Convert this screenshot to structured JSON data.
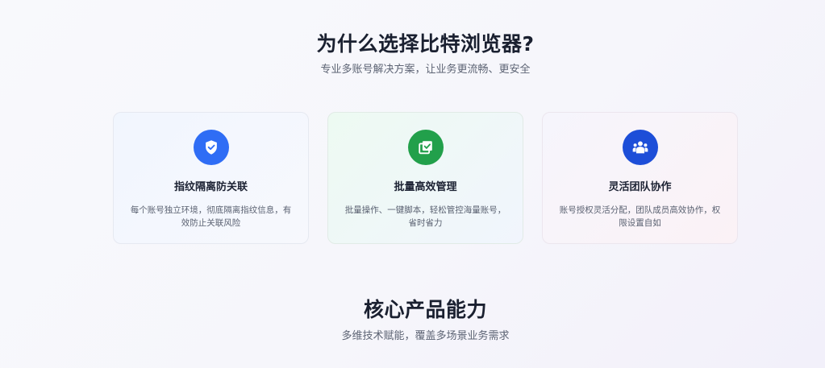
{
  "why_section": {
    "title": "为什么选择比特浏览器?",
    "subtitle": "专业多账号解决方案，让业务更流畅、更安全"
  },
  "features": [
    {
      "icon": "shield-check-icon",
      "icon_color": "#2f6df5",
      "title": "指纹隔离防关联",
      "description": "每个账号独立环境，彻底隔离指纹信息，有效防止关联风险"
    },
    {
      "icon": "batch-edit-icon",
      "icon_color": "#22a04b",
      "title": "批量高效管理",
      "description": "批量操作、一键脚本，轻松管控海量账号，省时省力"
    },
    {
      "icon": "team-icon",
      "icon_color": "#1d4ed8",
      "title": "灵活团队协作",
      "description": "账号授权灵活分配，团队成员高效协作，权限设置自如"
    }
  ],
  "core_section": {
    "title": "核心产品能力",
    "subtitle": "多维技术赋能，覆盖多场景业务需求"
  }
}
